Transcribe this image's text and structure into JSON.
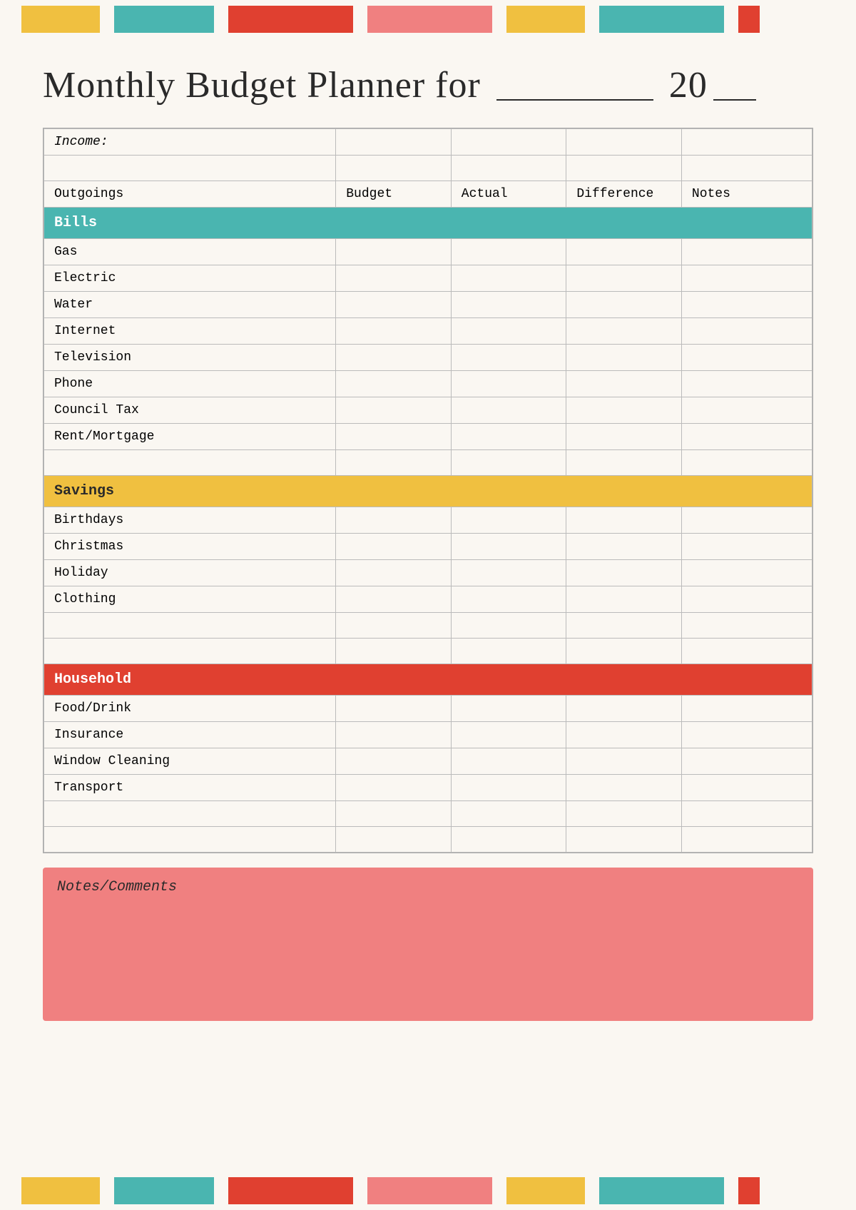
{
  "page": {
    "title": "Monthly Budget Planner for",
    "year_prefix": "20",
    "colors": {
      "yellow": "#f0c040",
      "teal": "#4ab5b0",
      "red": "#e04030",
      "pink": "#f08080"
    },
    "top_bars": [
      {
        "color": "yellow",
        "class": "bar-yellow seg1"
      },
      {
        "color": "teal",
        "class": "bar-teal seg2"
      },
      {
        "color": "red",
        "class": "bar-red seg3"
      },
      {
        "color": "pink",
        "class": "bar-pink seg4"
      },
      {
        "color": "yellow",
        "class": "bar-yellow seg5"
      },
      {
        "color": "teal",
        "class": "bar-teal seg6"
      },
      {
        "color": "red",
        "class": "bar-small-red seg7"
      }
    ],
    "table": {
      "income_label": "Income:",
      "columns": [
        "Outgoings",
        "Budget",
        "Actual",
        "Difference",
        "Notes"
      ],
      "sections": [
        {
          "name": "Bills",
          "color": "teal",
          "rows": [
            "Gas",
            "Electric",
            "Water",
            "Internet",
            "Television",
            "Phone",
            "Council Tax",
            "Rent/Mortgage"
          ]
        },
        {
          "name": "Savings",
          "color": "yellow",
          "rows": [
            "Birthdays",
            "Christmas",
            "Holiday",
            "Clothing",
            "",
            ""
          ]
        },
        {
          "name": "Household",
          "color": "red",
          "rows": [
            "Food/Drink",
            "Insurance",
            "Window Cleaning",
            "Transport",
            "",
            ""
          ]
        }
      ]
    },
    "notes_section": {
      "title": "Notes/Comments"
    }
  }
}
